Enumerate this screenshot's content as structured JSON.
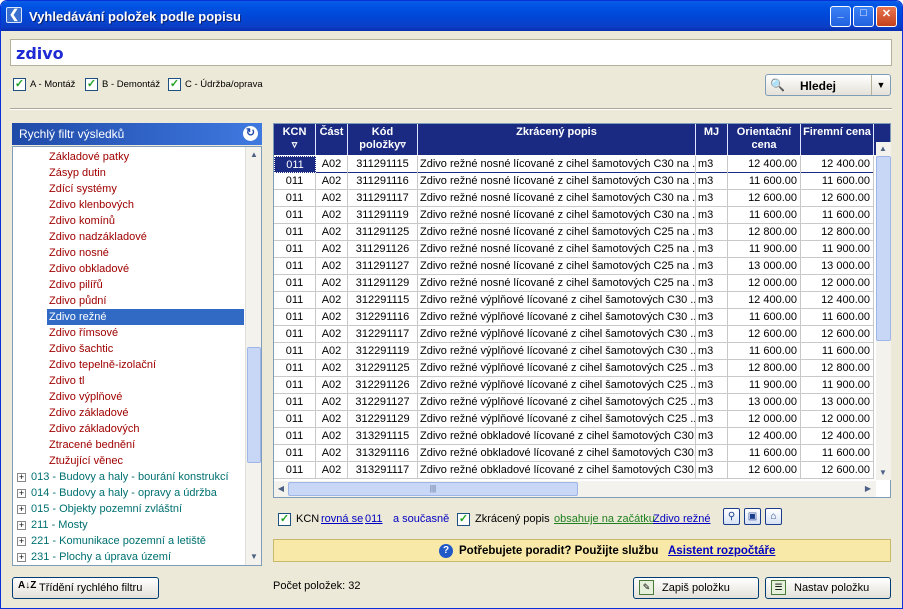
{
  "window": {
    "title": "Vyhledávání položek podle popisu",
    "min": "_",
    "max": "□",
    "close": "✕"
  },
  "search": {
    "value": "zdivo"
  },
  "options": [
    {
      "label": "A - Montáž",
      "checked": true
    },
    {
      "label": "B - Demontáž",
      "checked": true
    },
    {
      "label": "C - Údržba/oprava",
      "checked": true
    }
  ],
  "find_button": {
    "label": "Hledej",
    "icon": "magnifier-icon"
  },
  "quick_filter": {
    "title": "Rychlý filtr výsledků",
    "icon": "refresh-icon"
  },
  "tree": {
    "items": [
      "Základové patky",
      "Zásyp dutin",
      "Zdící systémy",
      "Zdivo klenbových",
      "Zdivo komínů",
      "Zdivo nadzákladové",
      "Zdivo nosné",
      "Zdivo obkladové",
      "Zdivo pilířů",
      "Zdivo půdní",
      "Zdivo režné",
      "Zdivo římsové",
      "Zdivo šachtic",
      "Zdivo tepelně-izolační",
      "Zdivo tl",
      "Zdivo výplňové",
      "Zdivo základové",
      "Zdivo základových",
      "Ztracené bednění",
      "Ztužující věnec"
    ],
    "selected": "Zdivo režné",
    "groups": [
      "013 - Budovy a haly - bourání konstrukcí",
      "014 - Budovy a haly - opravy a údržba",
      "015 - Objekty pozemní zvláštní",
      "211 - Mosty",
      "221 - Komunikace pozemní a letiště",
      "231 - Plochy a úprava území"
    ]
  },
  "sort_button": {
    "label": "Třídění rychlého filtru"
  },
  "grid": {
    "headers": [
      "KCN",
      "Část",
      "Kód položky",
      "Zkrácený popis",
      "MJ",
      "Orientační cena",
      "Firemní cena"
    ],
    "rows": [
      [
        "011",
        "A02",
        "311291115",
        "Zdivo režné nosné lícované z cihel šamotových C30 na ...",
        "m3",
        "12 400.00",
        "12 400.00"
      ],
      [
        "011",
        "A02",
        "311291116",
        "Zdivo režné nosné lícované z cihel šamotových C30 na ...",
        "m3",
        "11 600.00",
        "11 600.00"
      ],
      [
        "011",
        "A02",
        "311291117",
        "Zdivo režné nosné lícované z cihel šamotových C30 na ...",
        "m3",
        "12 600.00",
        "12 600.00"
      ],
      [
        "011",
        "A02",
        "311291119",
        "Zdivo režné nosné lícované z cihel šamotových C30 na ...",
        "m3",
        "11 600.00",
        "11 600.00"
      ],
      [
        "011",
        "A02",
        "311291125",
        "Zdivo režné nosné lícované z cihel šamotových C25 na ...",
        "m3",
        "12 800.00",
        "12 800.00"
      ],
      [
        "011",
        "A02",
        "311291126",
        "Zdivo režné nosné lícované z cihel šamotových C25 na ...",
        "m3",
        "11 900.00",
        "11 900.00"
      ],
      [
        "011",
        "A02",
        "311291127",
        "Zdivo režné nosné lícované z cihel šamotových C25 na ...",
        "m3",
        "13 000.00",
        "13 000.00"
      ],
      [
        "011",
        "A02",
        "311291129",
        "Zdivo režné nosné lícované z cihel šamotových C25 na ...",
        "m3",
        "12 000.00",
        "12 000.00"
      ],
      [
        "011",
        "A02",
        "312291115",
        "Zdivo režné výplňové lícované z cihel šamotových C30 ...",
        "m3",
        "12 400.00",
        "12 400.00"
      ],
      [
        "011",
        "A02",
        "312291116",
        "Zdivo režné výplňové lícované z cihel šamotových C30 ...",
        "m3",
        "11 600.00",
        "11 600.00"
      ],
      [
        "011",
        "A02",
        "312291117",
        "Zdivo režné výplňové lícované z cihel šamotových C30 ...",
        "m3",
        "12 600.00",
        "12 600.00"
      ],
      [
        "011",
        "A02",
        "312291119",
        "Zdivo režné výplňové lícované z cihel šamotových C30 ...",
        "m3",
        "11 600.00",
        "11 600.00"
      ],
      [
        "011",
        "A02",
        "312291125",
        "Zdivo režné výplňové lícované z cihel šamotových C25 ...",
        "m3",
        "12 800.00",
        "12 800.00"
      ],
      [
        "011",
        "A02",
        "312291126",
        "Zdivo režné výplňové lícované z cihel šamotových C25 ...",
        "m3",
        "11 900.00",
        "11 900.00"
      ],
      [
        "011",
        "A02",
        "312291127",
        "Zdivo režné výplňové lícované z cihel šamotových C25 ...",
        "m3",
        "13 000.00",
        "13 000.00"
      ],
      [
        "011",
        "A02",
        "312291129",
        "Zdivo režné výplňové lícované z cihel šamotových C25 ...",
        "m3",
        "12 000.00",
        "12 000.00"
      ],
      [
        "011",
        "A02",
        "313291115",
        "Zdivo režné obkladové lícované z cihel šamotových C30. ...",
        "m3",
        "12 400.00",
        "12 400.00"
      ],
      [
        "011",
        "A02",
        "313291116",
        "Zdivo režné obkladové lícované z cihel šamotových C30. ...",
        "m3",
        "11 600.00",
        "11 600.00"
      ],
      [
        "011",
        "A02",
        "313291117",
        "Zdivo režné obkladové lícované z cihel šamotových C30. ...",
        "m3",
        "12 600.00",
        "12 600.00"
      ]
    ]
  },
  "filter": {
    "kcn_label": "KCN",
    "kcn_op": "rovná se",
    "kcn_val": "011",
    "and_current": "a současně",
    "desc_label": "Zkrácený popis",
    "desc_op": "obsahuje na začátku",
    "desc_val": "Zdivo režné"
  },
  "help": {
    "text": "Potřebujete poradit? Použijte službu",
    "link": "Asistent rozpočtáře"
  },
  "count": {
    "label": "Počet položek: 32"
  },
  "buttons": {
    "write": "Zapiš položku",
    "set": "Nastav položku"
  }
}
